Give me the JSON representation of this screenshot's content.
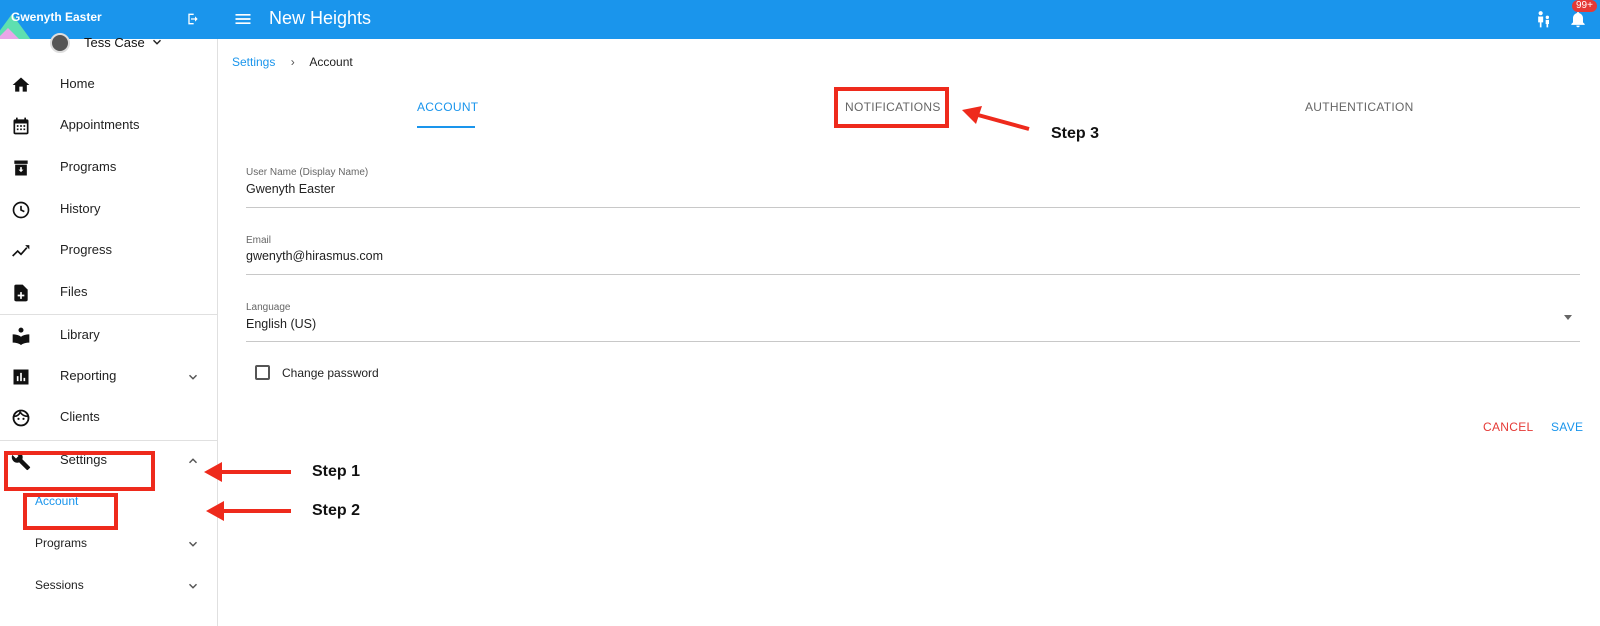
{
  "header": {
    "brand_name": "Gwenyth Easter",
    "app_title": "New Heights",
    "notification_badge": "99+"
  },
  "user": {
    "name": "Tess Case"
  },
  "sidebar": {
    "items": [
      {
        "label": "Home",
        "icon": "home-icon"
      },
      {
        "label": "Appointments",
        "icon": "calendar-icon"
      },
      {
        "label": "Programs",
        "icon": "archive-icon"
      },
      {
        "label": "History",
        "icon": "clock-icon"
      },
      {
        "label": "Progress",
        "icon": "trending-icon"
      },
      {
        "label": "Files",
        "icon": "file-add-icon"
      },
      {
        "label": "Library",
        "icon": "book-icon"
      },
      {
        "label": "Reporting",
        "icon": "bar-chart-icon"
      },
      {
        "label": "Clients",
        "icon": "face-icon"
      },
      {
        "label": "Settings",
        "icon": "wrench-icon"
      }
    ],
    "settings_sub": [
      {
        "label": "Account"
      },
      {
        "label": "Programs"
      },
      {
        "label": "Sessions"
      }
    ]
  },
  "breadcrumb": {
    "parent": "Settings",
    "current": "Account"
  },
  "tabs": [
    {
      "label": "ACCOUNT"
    },
    {
      "label": "NOTIFICATIONS"
    },
    {
      "label": "AUTHENTICATION"
    }
  ],
  "form": {
    "username_label": "User Name (Display Name)",
    "username_value": "Gwenyth Easter",
    "email_label": "Email",
    "email_value": "gwenyth@hirasmus.com",
    "language_label": "Language",
    "language_value": "English (US)",
    "change_password_label": "Change password",
    "cancel_label": "CANCEL",
    "save_label": "SAVE"
  },
  "annotations": {
    "step1": "Step 1",
    "step2": "Step 2",
    "step3": "Step 3"
  },
  "colors": {
    "primary": "#1a95ec",
    "danger": "#e53935",
    "annotation": "#ee2a1c"
  }
}
